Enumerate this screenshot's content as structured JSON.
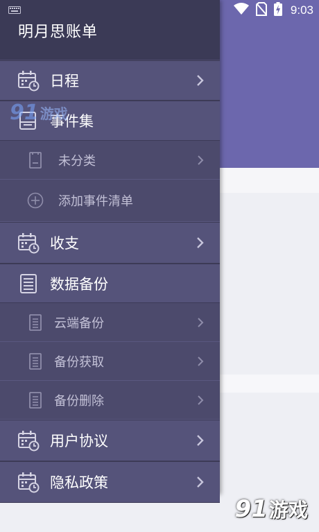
{
  "status_bar": {
    "time": "9:03"
  },
  "drawer": {
    "title": "明月思账单",
    "items": [
      {
        "label": "日程"
      },
      {
        "label": "事件集"
      },
      {
        "label": "未分类"
      },
      {
        "label": "添加事件清单"
      },
      {
        "label": "收支"
      },
      {
        "label": "数据备份"
      },
      {
        "label": "云端备份"
      },
      {
        "label": "备份获取"
      },
      {
        "label": "备份删除"
      },
      {
        "label": "用户协议"
      },
      {
        "label": "隐私政策"
      }
    ]
  },
  "watermark": {
    "logo_number": "91",
    "logo_text": "游戏"
  },
  "colors": {
    "accent": "#6c67ad",
    "drawer_bg": "#4c4a6c",
    "drawer_header": "#3b3a56",
    "row_bg": "#55537a"
  }
}
